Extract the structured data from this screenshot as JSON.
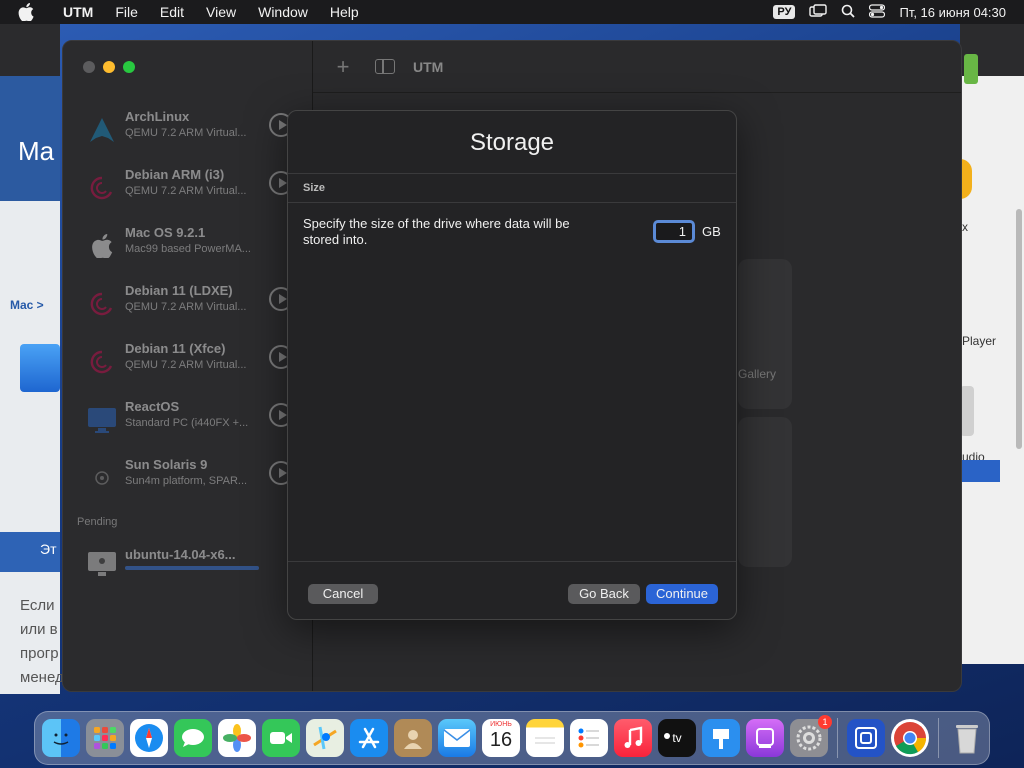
{
  "menubar": {
    "app_name": "UTM",
    "items": [
      "File",
      "Edit",
      "View",
      "Window",
      "Help"
    ],
    "input_lang": "РУ",
    "clock": "Пт, 16 июня  04:30"
  },
  "background": {
    "left_header": "Ma",
    "left_crumb": "Mac >",
    "left_strip": "Эт",
    "left_body": [
      "Если",
      "или в",
      "прогр",
      "менед"
    ],
    "right_label_player": "Player",
    "right_label_udio": "udio",
    "right_label_x": "x"
  },
  "utm": {
    "toolbar_title": "UTM",
    "vms": [
      {
        "name": "ArchLinux",
        "desc": "QEMU 7.2 ARM Virtual...",
        "icon": "arch-linux-icon",
        "color": "#1793d1"
      },
      {
        "name": "Debian ARM (i3)",
        "desc": "QEMU 7.2 ARM Virtual...",
        "icon": "debian-icon",
        "color": "#d70a53"
      },
      {
        "name": "Mac OS 9.2.1",
        "desc": "Mac99 based PowerMA...",
        "icon": "apple-icon",
        "color": "#ffffff"
      },
      {
        "name": "Debian 11 (LDXE)",
        "desc": "QEMU 7.2 ARM Virtual...",
        "icon": "debian-icon",
        "color": "#d70a53"
      },
      {
        "name": "Debian 11 (Xfce)",
        "desc": "QEMU 7.2 ARM Virtual...",
        "icon": "debian-icon",
        "color": "#d70a53"
      },
      {
        "name": "ReactOS",
        "desc": "Standard PC (i440FX +...",
        "icon": "reactos-icon",
        "color": "#2a6fd6"
      },
      {
        "name": "Sun Solaris 9",
        "desc": "Sun4m platform, SPAR...",
        "icon": "solaris-icon",
        "color": "#999999"
      }
    ],
    "pending_label": "Pending",
    "pending_vm": {
      "name": "ubuntu-14.04-x6...",
      "progress": 1.0
    },
    "gallery_text": "Gallery"
  },
  "dialog": {
    "title": "Storage",
    "section": "Size",
    "description": "Specify the size of the drive where data will be stored into.",
    "size_value": "1",
    "unit": "GB",
    "cancel": "Cancel",
    "go_back": "Go Back",
    "continue": "Continue"
  },
  "dock": {
    "calendar_month": "ИЮНЬ",
    "calendar_day": "16",
    "settings_badge": "1",
    "apps": [
      "finder-icon",
      "launchpad-icon",
      "safari-icon",
      "messages-icon",
      "photos-icon",
      "facetime-icon",
      "maps-icon",
      "app-store-icon",
      "contacts-icon",
      "mail-icon",
      "calendar-icon",
      "notes-icon",
      "reminders-icon",
      "music-icon",
      "apple-tv-icon",
      "keynote-icon",
      "podcasts-icon",
      "system-settings-icon",
      "utm-icon",
      "chrome-icon",
      "trash-icon"
    ]
  }
}
